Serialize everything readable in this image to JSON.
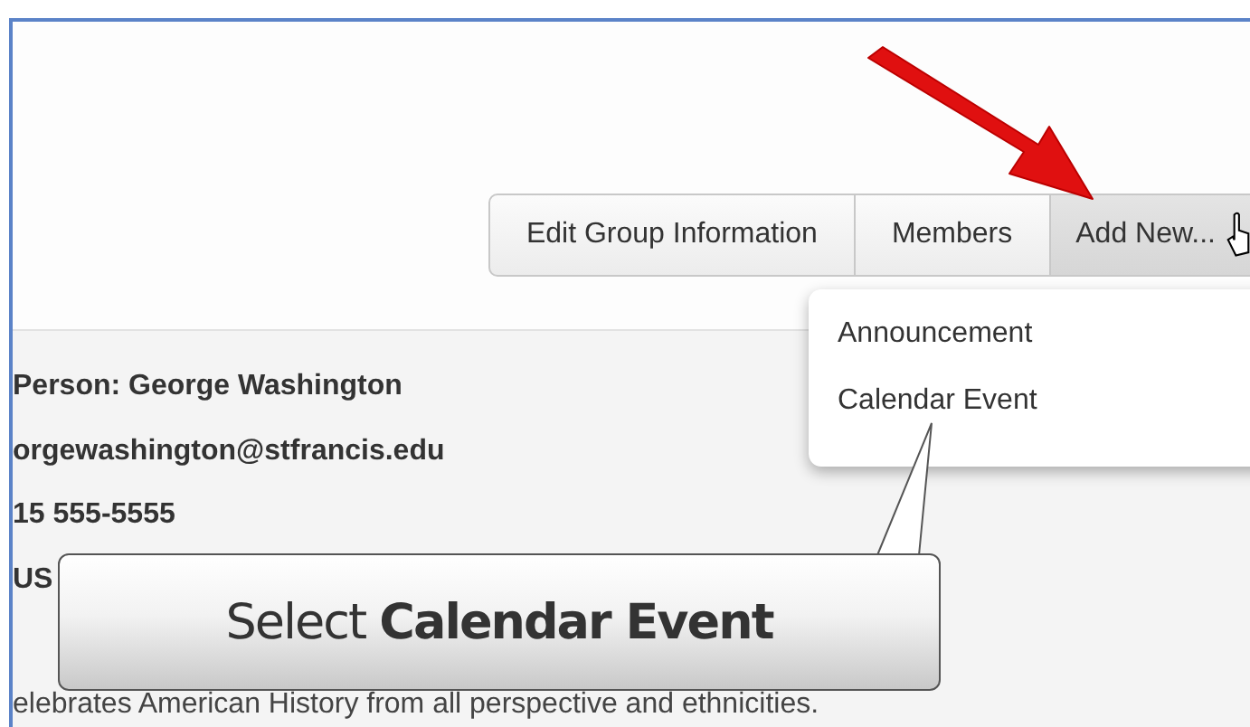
{
  "toolbar": {
    "buttons": [
      {
        "label": "Edit Group Information",
        "expanded": false
      },
      {
        "label": "Members",
        "expanded": false
      },
      {
        "label": "Add New...",
        "expanded": true
      }
    ]
  },
  "menu": {
    "items": [
      {
        "label": "Announcement"
      },
      {
        "label": "Calendar Event"
      }
    ]
  },
  "details": {
    "lines": [
      {
        "text": "Person: George Washington"
      },
      {
        "text": "orgewashington@stfrancis.edu"
      },
      {
        "text": "15 555-5555"
      },
      {
        "text": "US"
      }
    ],
    "description": "elebrates American History from all perspective and ethnicities."
  },
  "callout": {
    "text": "Select **Calendar Event**"
  }
}
